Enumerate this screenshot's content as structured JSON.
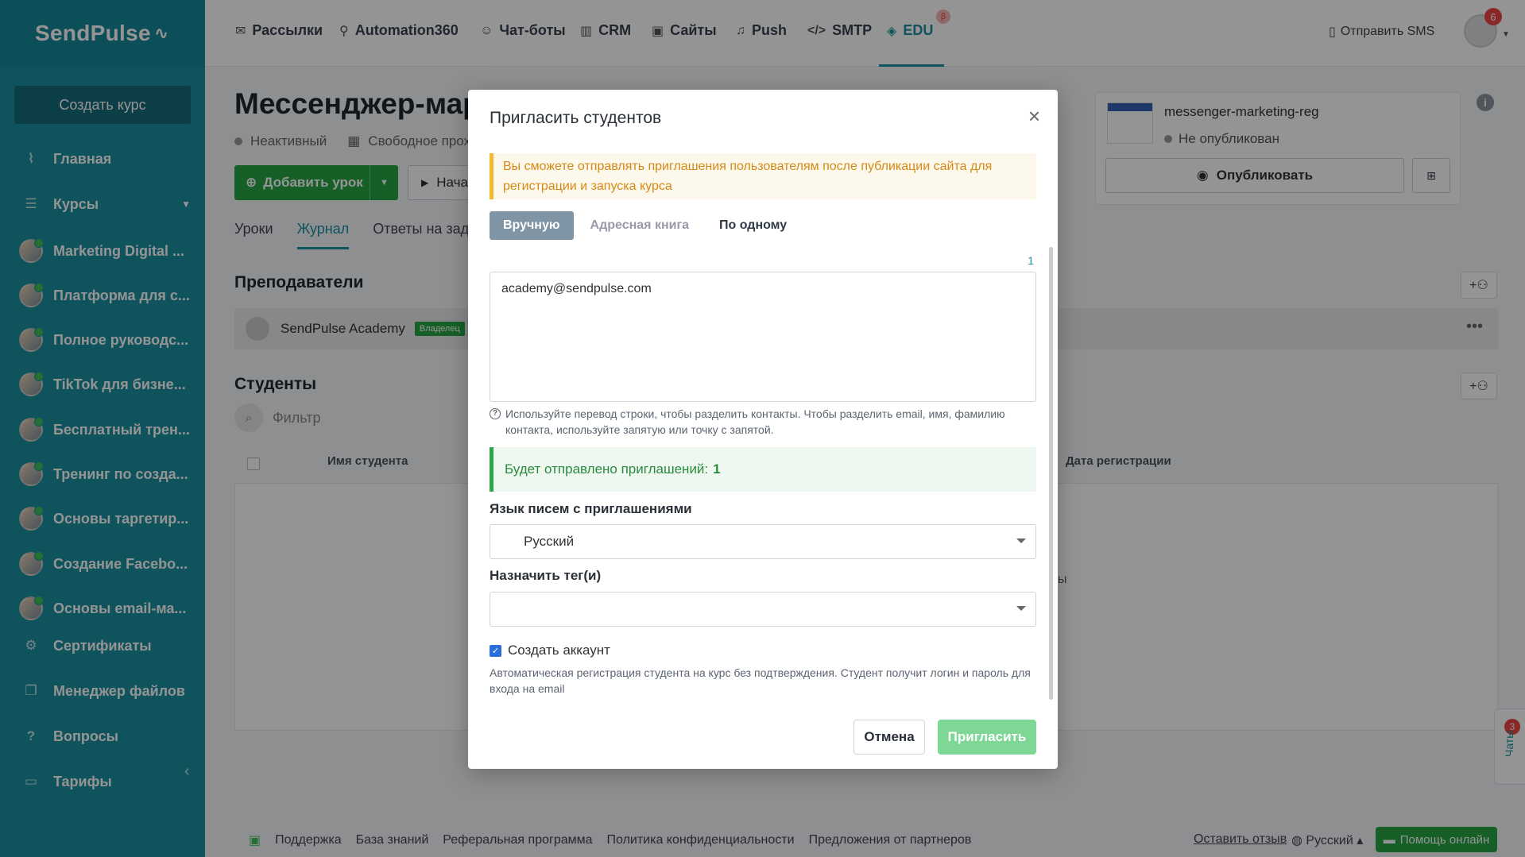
{
  "app": {
    "logo": "SendPulse"
  },
  "sidebar": {
    "create_button": "Создать курс",
    "items": [
      {
        "label": "Главная",
        "icon": "chart-icon"
      },
      {
        "label": "Курсы",
        "icon": "courses-icon"
      },
      {
        "label": "Marketing Digital ..."
      },
      {
        "label": "Платформа для с..."
      },
      {
        "label": "Полное руководс..."
      },
      {
        "label": "TikTok для бизне..."
      },
      {
        "label": "Бесплатный трен..."
      },
      {
        "label": "Тренинг по созда..."
      },
      {
        "label": "Основы таргетир..."
      },
      {
        "label": "Создание Facebo..."
      },
      {
        "label": "Основы email-ма..."
      },
      {
        "label": "Сертификаты",
        "icon": "gear-icon"
      },
      {
        "label": "Менеджер файлов",
        "icon": "files-icon"
      },
      {
        "label": "Вопросы",
        "icon": "question-icon"
      },
      {
        "label": "Тарифы",
        "icon": "wallet-icon"
      }
    ]
  },
  "topnav": {
    "items": [
      "Рассылки",
      "Automation360",
      "Чат-боты",
      "CRM",
      "Сайты",
      "Push",
      "SMTP",
      "EDU"
    ],
    "active": "EDU",
    "beta": "β",
    "sms": "Отправить SMS",
    "notifications": "6"
  },
  "page": {
    "title": "Мессенджер-мар",
    "status": "Неактивный",
    "access": "Свободное прох",
    "add_lesson": "Добавить урок",
    "start": "Нача",
    "tabs": [
      "Уроки",
      "Журнал",
      "Ответы на зад"
    ],
    "teachers_title": "Преподаватели",
    "teacher_name": "SendPulse Academy",
    "owner_badge": "Владелец",
    "students_title": "Студенты",
    "filter_placeholder": "Фильтр",
    "col_name": "Имя студента",
    "col_date": "Дата регистрации",
    "partial_text": "ы"
  },
  "site_card": {
    "name": "messenger-marketing-reg",
    "status": "Не опубликован",
    "publish": "Опубликовать"
  },
  "footer": {
    "links": [
      "Поддержка",
      "База знаний",
      "Реферальная программа",
      "Политика конфиденциальности",
      "Предложения от партнеров"
    ],
    "feedback": "Оставить отзыв",
    "language": "Русский",
    "help": "Помощь онлайн",
    "chats": "Чаты",
    "chats_count": "3"
  },
  "modal": {
    "title": "Пригласить студентов",
    "warning": "Вы сможете отправлять приглашения пользователям после публикации сайта для регистрации и запуска курса",
    "tabs": [
      "Вручную",
      "Адресная книга",
      "По одному"
    ],
    "counter": "1",
    "textarea_value": "academy@sendpulse.com",
    "hint": "Используйте перевод строки, чтобы разделить контакты. Чтобы разделить email, имя, фамилию контакта, используйте запятую или точку с запятой.",
    "success_text": "Будет отправлено приглашений:",
    "success_count": "1",
    "language_label": "Язык писем с приглашениями",
    "language_value": "Русский",
    "tags_label": "Назначить тег(и)",
    "tags_value": "",
    "create_account": "Создать аккаунт",
    "create_account_desc": "Автоматическая регистрация студента на курс без подтверждения. Студент получит логин и пароль для входа на email",
    "cancel": "Отмена",
    "invite": "Пригласить"
  }
}
